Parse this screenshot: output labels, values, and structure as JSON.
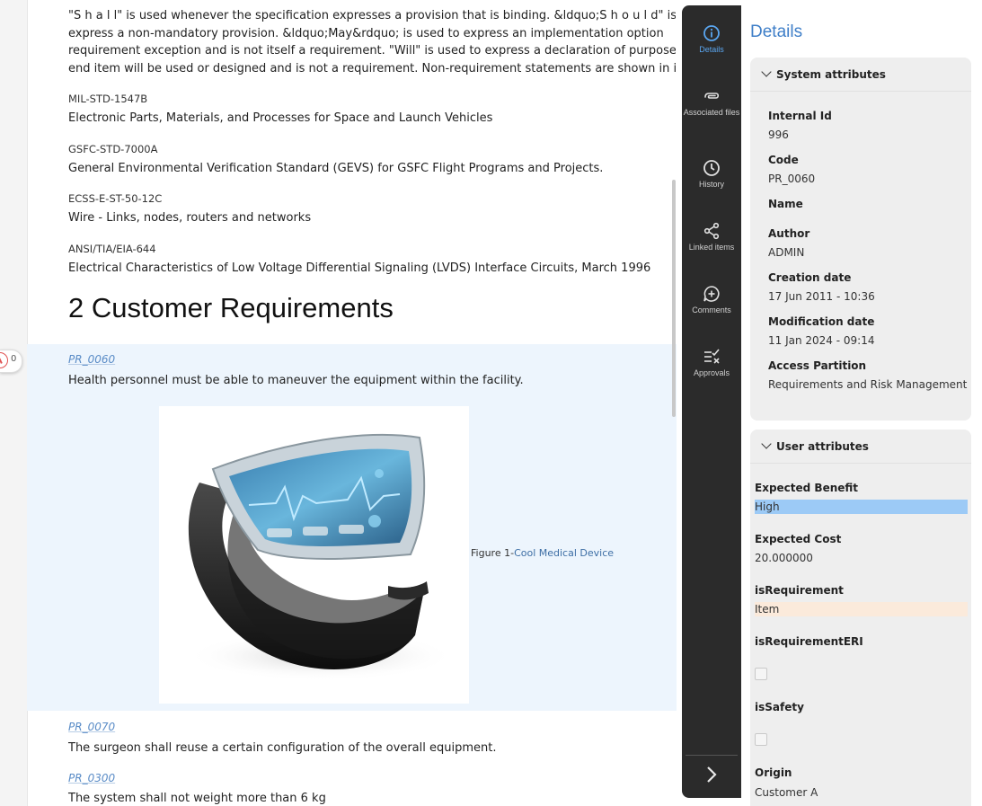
{
  "document": {
    "intro_lines": [
      "\"S h a l l\" is used whenever the specification expresses a provision that is binding. &ldquo;S h o u l d\" is used",
      "express a non-mandatory provision. &ldquo;May&rdquo; is used to express an implementation option",
      "requirement exception and is not itself a requirement. \"Will\" is used to express a declaration of purpose on how t",
      "end item will be used or designed and is not a requirement. Non-requirement statements are shown in italics."
    ],
    "references": [
      {
        "code": "MIL-STD-1547B",
        "title": "Electronic Parts, Materials, and Processes for Space and Launch Vehicles"
      },
      {
        "code": "GSFC-STD-7000A",
        "title": "General Environmental Verification Standard (GEVS) for GSFC Flight Programs and Projects."
      },
      {
        "code": "ECSS-E-ST-50-12C",
        "title": "Wire - Links, nodes, routers and networks"
      },
      {
        "code": "ANSI/TIA/EIA-644",
        "title": "Electrical Characteristics of Low Voltage Differential Signaling (LVDS) Interface Circuits, March 1996"
      }
    ],
    "section_heading": "2  Customer Requirements",
    "comment_count": "0",
    "requirements": [
      {
        "id": "PR_0060",
        "text": "Health personnel must be able to maneuver the equipment within the facility."
      },
      {
        "id": "PR_0070",
        "text": "The surgeon shall  reuse a certain configuration of the overall equipment."
      },
      {
        "id": "PR_0300",
        "text": "The system shall not weight more than 6 kg"
      }
    ],
    "figure": {
      "caption_prefix": "Figure 1-",
      "caption_text": "Cool Medical Device"
    }
  },
  "nav": {
    "items": [
      {
        "label": "Details",
        "icon": "info-icon",
        "active": true
      },
      {
        "label": "Associated files",
        "icon": "paperclip-icon"
      },
      {
        "label": "History",
        "icon": "clock-icon"
      },
      {
        "label": "Linked items",
        "icon": "share-icon"
      },
      {
        "label": "Comments",
        "icon": "comment-add-icon"
      },
      {
        "label": "Approvals",
        "icon": "approvals-icon"
      }
    ],
    "expand_icon": "chevron-right-icon"
  },
  "panel": {
    "title": "Details",
    "system": {
      "header": "System attributes",
      "internal_id_label": "Internal Id",
      "internal_id": "996",
      "code_label": "Code",
      "code": "PR_0060",
      "name_label": "Name",
      "author_label": "Author",
      "author": "ADMIN",
      "creation_label": "Creation date",
      "creation": "17 Jun 2011 - 10:36",
      "modification_label": "Modification date",
      "modification": "11 Jan 2024 - 09:14",
      "partition_label": "Access Partition",
      "partition": "Requirements and Risk Management"
    },
    "user": {
      "header": "User attributes",
      "benefit_label": "Expected Benefit",
      "benefit": "High",
      "benefit_color": "#9ccaf6",
      "cost_label": "Expected Cost",
      "cost": "20.000000",
      "isreq_label": "isRequirement",
      "isreq": "Item",
      "isreq_color": "#fbeadb",
      "isreqeri_label": "isRequirementERI",
      "isreqeri_checked": false,
      "issafety_label": "isSafety",
      "issafety_checked": false,
      "origin_label": "Origin",
      "origin": "Customer A"
    }
  }
}
